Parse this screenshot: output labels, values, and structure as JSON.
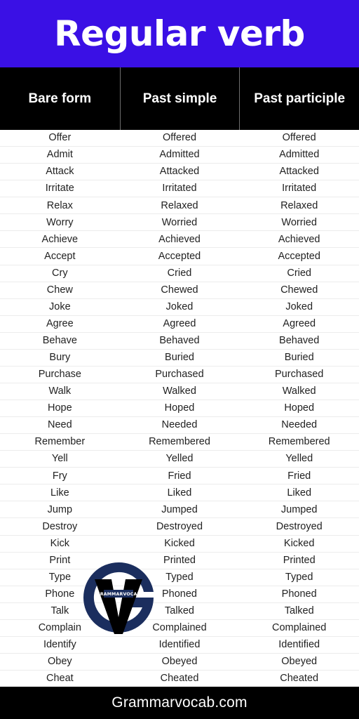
{
  "header": {
    "title": "Regular verb",
    "background_color": "#3a10e5"
  },
  "table": {
    "columns": [
      "Bare form",
      "Past simple",
      "Past participle"
    ],
    "header_background_color": "#000000",
    "row_separator_color": "#ececec",
    "rows": [
      [
        "Offer",
        "Offered",
        "Offered"
      ],
      [
        "Admit",
        "Admitted",
        "Admitted"
      ],
      [
        "Attack",
        "Attacked",
        "Attacked"
      ],
      [
        "Irritate",
        "Irritated",
        "Irritated"
      ],
      [
        "Relax",
        "Relaxed",
        "Relaxed"
      ],
      [
        "Worry",
        "Worried",
        "Worried"
      ],
      [
        "Achieve",
        "Achieved",
        "Achieved"
      ],
      [
        "Accept",
        "Accepted",
        "Accepted"
      ],
      [
        "Cry",
        "Cried",
        "Cried"
      ],
      [
        "Chew",
        "Chewed",
        "Chewed"
      ],
      [
        "Joke",
        "Joked",
        "Joked"
      ],
      [
        "Agree",
        "Agreed",
        "Agreed"
      ],
      [
        "Behave",
        "Behaved",
        "Behaved"
      ],
      [
        "Bury",
        "Buried",
        "Buried"
      ],
      [
        "Purchase",
        "Purchased",
        "Purchased"
      ],
      [
        "Walk",
        "Walked",
        "Walked"
      ],
      [
        "Hope",
        "Hoped",
        "Hoped"
      ],
      [
        "Need",
        "Needed",
        "Needed"
      ],
      [
        "Remember",
        "Remembered",
        "Remembered"
      ],
      [
        "Yell",
        "Yelled",
        "Yelled"
      ],
      [
        "Fry",
        "Fried",
        "Fried"
      ],
      [
        "Like",
        "Liked",
        "Liked"
      ],
      [
        "Jump",
        "Jumped",
        "Jumped"
      ],
      [
        "Destroy",
        "Destroyed",
        "Destroyed"
      ],
      [
        "Kick",
        "Kicked",
        "Kicked"
      ],
      [
        "Print",
        "Printed",
        "Printed"
      ],
      [
        "Type",
        "Typed",
        "Typed"
      ],
      [
        "Phone",
        "Phoned",
        "Phoned"
      ],
      [
        "Talk",
        "Talked",
        "Talked"
      ],
      [
        "Complain",
        "Complained",
        "Complained"
      ],
      [
        "Identify",
        "Identified",
        "Identified"
      ],
      [
        "Obey",
        "Obeyed",
        "Obeyed"
      ],
      [
        "Cheat",
        "Cheated",
        "Cheated"
      ]
    ]
  },
  "watermark": {
    "icon": "grammarvocab-logo-icon",
    "badge_text": "GRAMMARVOCAB",
    "ring_color": "#1b2e5e",
    "mark_color": "#000000"
  },
  "footer": {
    "text": "Grammarvocab.com",
    "background_color": "#000000"
  }
}
